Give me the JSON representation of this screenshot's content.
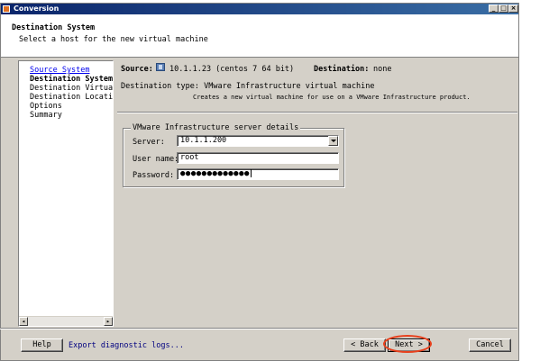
{
  "window": {
    "title": "Conversion",
    "controls": [
      "minimize",
      "maximize",
      "close"
    ]
  },
  "header": {
    "title": "Destination System",
    "subtitle": "Select a host for the new virtual machine"
  },
  "nav": {
    "items": [
      {
        "label": "Source System",
        "state": "link"
      },
      {
        "label": "Destination System",
        "state": "current"
      },
      {
        "label": "Destination Virtual M",
        "state": "normal"
      },
      {
        "label": "Destination Location",
        "state": "normal"
      },
      {
        "label": "Options",
        "state": "normal"
      },
      {
        "label": "Summary",
        "state": "normal"
      }
    ]
  },
  "summary": {
    "source_label": "Source:",
    "source_value": "10.1.1.23 (centos 7 64 bit)",
    "destination_label": "Destination:",
    "destination_value": "none",
    "dest_type_text": "Destination type: VMware Infrastructure virtual machine",
    "dest_type_desc": "Creates a new virtual machine for use on a VMware Infrastructure product."
  },
  "server_details": {
    "legend": "VMware Infrastructure server details",
    "server_label": "Server:",
    "server_value": "10.1.1.200",
    "username_label": "User name:",
    "username_value": "root",
    "password_label": "Password:",
    "password_value": "●●●●●●●●●●●●●"
  },
  "footer": {
    "help_label": "Help",
    "export_link": "Export diagnostic logs...",
    "back_label": "< Back",
    "next_label": "Next >",
    "cancel_label": "Cancel"
  },
  "colors": {
    "titlebar_start": "#0a246a",
    "titlebar_end": "#3a6ea5",
    "highlight_oval": "#e8401c",
    "link": "#0000ee"
  }
}
